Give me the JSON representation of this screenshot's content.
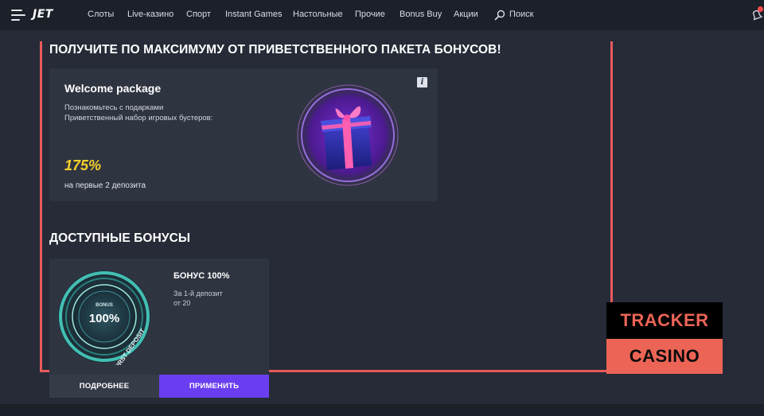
{
  "nav": {
    "logo": "JET",
    "items": [
      "Слоты",
      "Live-казино",
      "Спорт",
      "Instant Games",
      "Настольные",
      "Прочие",
      "Bonus Buy",
      "Акции"
    ],
    "search_label": "Поиск"
  },
  "welcome": {
    "heading": "ПОЛУЧИТЕ ПО МАКСИМУМУ ОТ ПРИВЕТСТВЕННОГО ПАКЕТА БОНУСОВ!",
    "card_title": "Welcome package",
    "line1": "Познакомьтесь с подарками",
    "line2": "Приветственный набор игровых бустеров:",
    "percent": "175%",
    "sub": "на первые 2 депозита",
    "info": "i"
  },
  "available": {
    "heading": "ДОСТУПНЫЕ БОНУСЫ",
    "bonus_title": "БОНУС 100%",
    "bonus_line1": "За 1-й депозит",
    "bonus_line2": "от 20",
    "badge_percent": "100%",
    "badge_top": "BONUS",
    "badge_ring": "FIRST DEPOSIT",
    "more_button": "ПОДРОБНЕЕ",
    "apply_button": "ПРИМЕНИТЬ"
  },
  "watermark": {
    "line1": "TRACKER",
    "line2": "CASINO"
  },
  "colors": {
    "accent_purple": "#6a3ef0",
    "percent_yellow": "#f5cf2c",
    "frame_red": "#e85a5a"
  },
  "icons": [
    "menu-icon",
    "search-icon",
    "notification-icon",
    "info-icon"
  ]
}
